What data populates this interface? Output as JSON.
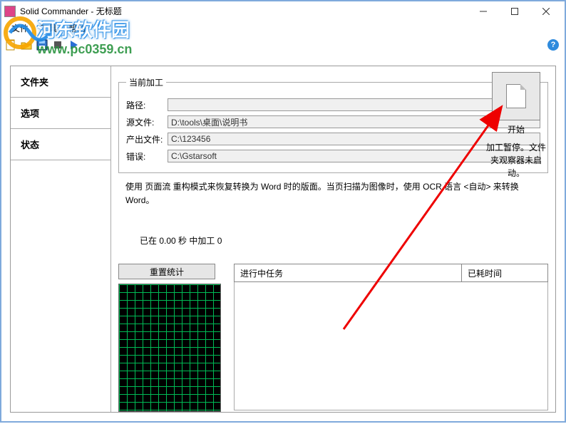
{
  "window": {
    "title": "Solid Commander - 无标题"
  },
  "menu": {
    "file": "文件",
    "tools": "工具",
    "help": "帮助"
  },
  "sidebar": {
    "tabs": [
      "文件夹",
      "选项",
      "状态"
    ]
  },
  "processing": {
    "group_title": "当前加工",
    "path_label": "路径:",
    "path_value": "",
    "source_label": "源文件:",
    "source_value": "D:\\tools\\桌面\\说明书",
    "output_label": "产出文件:",
    "output_value": "C:\\123456",
    "error_label": "错误:",
    "error_value": "C:\\Gstarsoft",
    "desc": "使用 页面流 重构模式来恢复转换为 Word 时的版面。当页扫描为图像时，使用 OCR 语言 <自动> 来转换 Word。"
  },
  "start": {
    "label": "开始",
    "status": "加工暂停。文件夹观察器未启动。"
  },
  "stats": {
    "line": "已在 0.00 秒 中加工 0",
    "reset": "重置统计"
  },
  "tasks": {
    "col_running": "进行中任务",
    "col_elapsed": "已耗时间"
  },
  "watermark": {
    "brand": "河东软件园",
    "url": "www.pc0359.cn"
  }
}
